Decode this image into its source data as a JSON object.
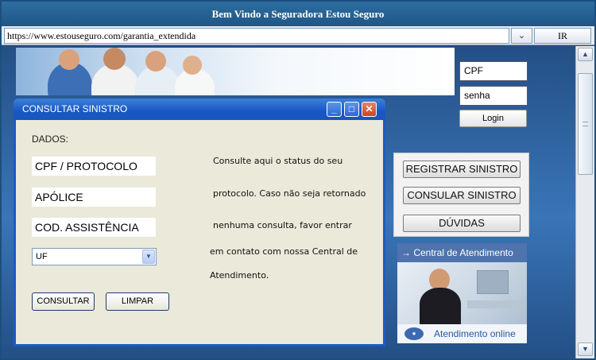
{
  "window": {
    "title": "Bem Vindo a Seguradora Estou Seguro"
  },
  "address_bar": {
    "url": "https://www.estouseguro.com/garantia_extendida",
    "go_label": "IR"
  },
  "login": {
    "cpf_placeholder": "CPF",
    "senha_placeholder": "senha",
    "login_label": "Login"
  },
  "side_menu": {
    "items": [
      {
        "label": "REGISTRAR SINISTRO"
      },
      {
        "label": "CONSULAR SINISTRO"
      },
      {
        "label": "DÚVIDAS"
      }
    ]
  },
  "atendimento": {
    "header": "→ Central de Atendimento",
    "footer": "Atendimento online"
  },
  "dialog": {
    "title": "CONSULTAR SINISTRO",
    "dados_label": "DADOS:",
    "fields": {
      "cpf_protocolo": "CPF / PROTOCOLO",
      "apolice": "APÓLICE",
      "cod_assistencia": "COD. ASSISTÊNCIA"
    },
    "uf_selected": "UF",
    "consultar_label": "CONSULTAR",
    "limpar_label": "LIMPAR",
    "help_lines": [
      "Consulte aqui o status do seu",
      "protocolo. Caso não seja retornado",
      "nenhuma consulta, favor entrar",
      "em contato com nossa Central de",
      "Atendimento."
    ]
  },
  "colors": {
    "titlebar": "#1f5687",
    "content_bg": "#3a75b8",
    "dialog_title": "#1857c4",
    "dialog_bg": "#ebe9d9"
  }
}
